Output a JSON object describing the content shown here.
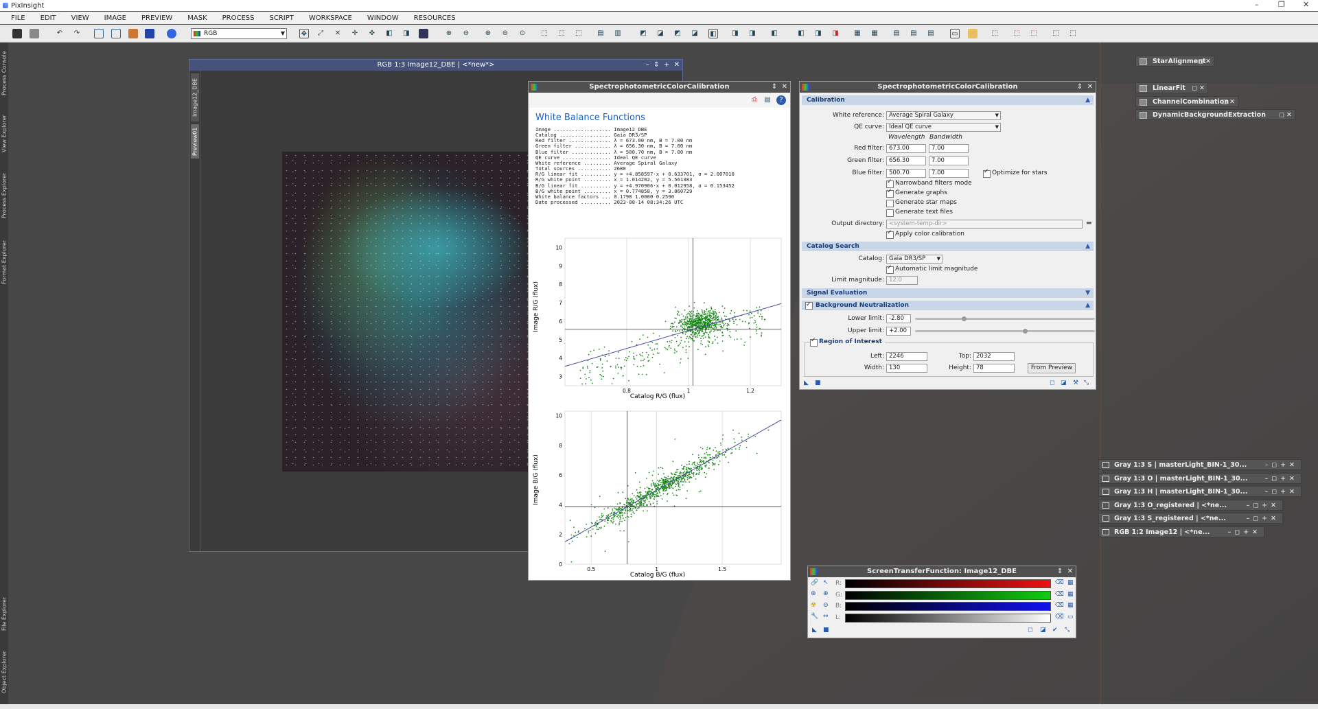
{
  "app": {
    "title": "PixInsight"
  },
  "menu": [
    "FILE",
    "EDIT",
    "VIEW",
    "IMAGE",
    "PREVIEW",
    "MASK",
    "PROCESS",
    "SCRIPT",
    "WORKSPACE",
    "WINDOW",
    "RESOURCES"
  ],
  "toolbar": {
    "channel_combo": "RGB"
  },
  "left_tabs": [
    "Process Console",
    "View Explorer",
    "Process Explorer",
    "Format Explorer",
    "File Explorer",
    "Object Explorer"
  ],
  "image_window": {
    "title": "RGB 1:3 Image12_DBE | <*new*>",
    "side_tabs": [
      "Image12_DBE",
      "Preview01"
    ]
  },
  "graph_panel": {
    "title": "SpectrophotometricColorCalibration",
    "heading": "White Balance Functions",
    "info": [
      "Image ................... Image12_DBE",
      "Catalog ................. Gaia DR3/SP",
      "Red filter .............. λ = 673.00 nm, B = 7.00 nm",
      "Green filter ............ λ = 656.30 nm, B = 7.00 nm",
      "Blue filter ............. λ = 500.70 nm, B = 7.00 nm",
      "QE curve ................ Ideal QE curve",
      "White reference ......... Average Spiral Galaxy",
      "Total sources ........... 2680",
      "R/G linear fit .......... y = +4.858597·x + 0.633701, σ = 2.007010",
      "R/G white point ......... x = 1.014202, y = 5.561383",
      "B/G linear fit .......... y = +4.970906·x + 0.012958, σ = 0.153452",
      "B/G white point ......... x = 0.774858, y = 3.860729",
      "White balance factors ... 0.1798 1.0000 0.2590",
      "Date processed .......... 2023-08-14 08:34:26 UTC"
    ],
    "plot1": {
      "ylabel": "Image R/G (flux)",
      "xlabel": "Catalog R/G (flux)",
      "yticks": [
        "3",
        "4",
        "5",
        "6",
        "7",
        "8",
        "9",
        "10"
      ],
      "xticks": [
        "0.8",
        "1",
        "1.2"
      ]
    },
    "plot2": {
      "ylabel": "Image B/G (flux)",
      "xlabel": "Catalog B/G (flux)",
      "yticks": [
        "0",
        "2",
        "4",
        "6",
        "8",
        "10"
      ],
      "xticks": [
        "0.5",
        "1",
        "1.5"
      ]
    }
  },
  "chart_data": [
    {
      "type": "scatter",
      "xlabel": "Catalog R/G (flux)",
      "ylabel": "Image R/G (flux)",
      "xlim": [
        0.6,
        1.3
      ],
      "ylim": [
        2.5,
        10.5
      ],
      "fit": {
        "slope": 4.858597,
        "intercept": 0.633701
      },
      "white_point": {
        "x": 1.014202,
        "y": 5.561383
      },
      "cluster": {
        "x": 1.04,
        "y": 5.9,
        "sx": 0.04,
        "sy": 0.35
      },
      "color": "#1a8a1a"
    },
    {
      "type": "scatter",
      "xlabel": "Catalog B/G (flux)",
      "ylabel": "Image B/G (flux)",
      "xlim": [
        0.3,
        1.95
      ],
      "ylim": [
        0,
        10.3
      ],
      "fit": {
        "slope": 4.970906,
        "intercept": 0.012958
      },
      "white_point": {
        "x": 0.774858,
        "y": 3.860729
      },
      "cluster": {
        "x": 1.0,
        "y": 5.0,
        "sx": 0.28,
        "sy": 1.35
      },
      "color": "#1a8a1a"
    }
  ],
  "spcc": {
    "title": "SpectrophotometricColorCalibration",
    "calibration": "Calibration",
    "white_reference_label": "White reference:",
    "white_reference": "Average Spiral Galaxy",
    "qe_label": "QE curve:",
    "qe": "Ideal QE curve",
    "wavelength": "Wavelength",
    "bandwidth": "Bandwidth",
    "red_label": "Red filter:",
    "red_wl": "673.00",
    "red_bw": "7.00",
    "green_label": "Green filter:",
    "green_wl": "656.30",
    "green_bw": "7.00",
    "blue_label": "Blue filter:",
    "blue_wl": "500.70",
    "blue_bw": "7.00",
    "optimize": "Optimize for stars",
    "narrowband": "Narrowband filters mode",
    "gen_graphs": "Generate graphs",
    "gen_star_maps": "Generate star maps",
    "gen_text": "Generate text files",
    "output_label": "Output directory:",
    "output_placeholder": "<system-temp-dir>",
    "apply": "Apply color calibration",
    "catalog_search": "Catalog Search",
    "catalog_label": "Catalog:",
    "catalog": "Gaia DR3/SP",
    "auto_limit": "Automatic limit magnitude",
    "limit_label": "Limit magnitude:",
    "limit": "12.0",
    "signal_eval": "Signal Evaluation",
    "bg_neutral": "Background Neutralization",
    "lower_label": "Lower limit:",
    "lower": "-2.80",
    "upper_label": "Upper limit:",
    "upper": "+2.00",
    "lower_level": 0.26,
    "upper_level": 0.6,
    "roi": "Region of Interest",
    "left_label": "Left:",
    "left": "2246",
    "top_label": "Top:",
    "top": "2032",
    "width_label": "Width:",
    "width": "130",
    "height_label": "Height:",
    "height": "78",
    "from_preview": "From Preview"
  },
  "stf": {
    "title": "ScreenTransferFunction: Image12_DBE",
    "channels": [
      "R:",
      "G:",
      "B:",
      "L:"
    ]
  },
  "icons_right": [
    "StarAlignment",
    "LinearFit",
    "ChannelCombination",
    "DynamicBackgroundExtraction"
  ],
  "shaded_windows": [
    "Gray 1:3 S | masterLight_BIN-1_30...",
    "Gray 1:3 O | masterLight_BIN-1_30...",
    "Gray 1:3 H | masterLight_BIN-1_30...",
    "Gray 1:3 O_registered | <*ne...",
    "Gray 1:3 S_registered | <*ne...",
    "RGB 1:2 Image12 | <*ne..."
  ]
}
